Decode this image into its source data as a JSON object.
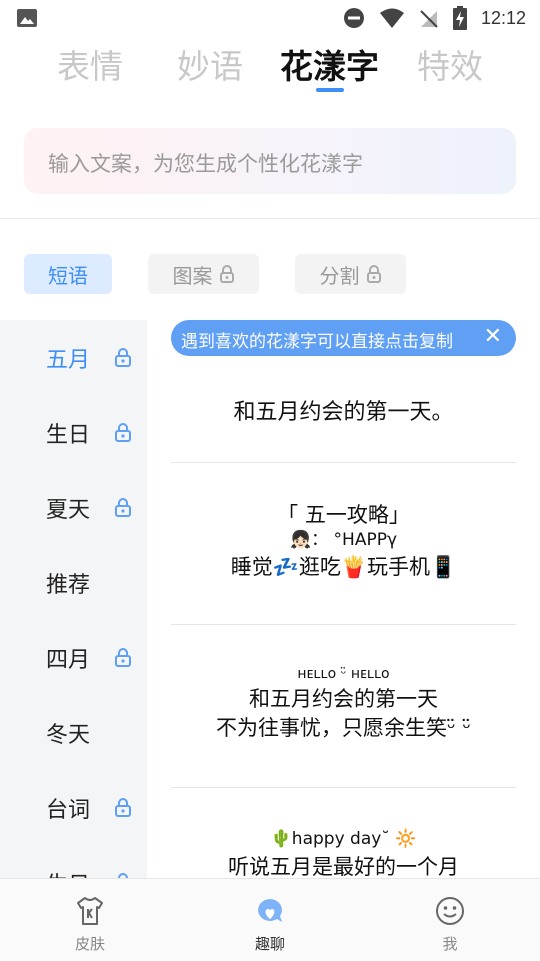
{
  "status_bar": {
    "time": "12:12"
  },
  "tabs": [
    {
      "label": "表情"
    },
    {
      "label": "妙语"
    },
    {
      "label": "花漾字"
    },
    {
      "label": "特效"
    }
  ],
  "search": {
    "placeholder": "输入文案，为您生成个性化花漾字"
  },
  "categories": [
    {
      "label": "短语"
    },
    {
      "label": "图案"
    },
    {
      "label": "分割"
    }
  ],
  "sidebar": {
    "items": [
      {
        "label": "五月"
      },
      {
        "label": "生日"
      },
      {
        "label": "夏天"
      },
      {
        "label": "推荐"
      },
      {
        "label": "四月"
      },
      {
        "label": "冬天"
      },
      {
        "label": "台词"
      },
      {
        "label": "生日"
      }
    ]
  },
  "tip": {
    "text": "遇到喜欢的花漾字可以直接点击复制",
    "close": "✕"
  },
  "cards": {
    "c1": {
      "line1": "和五月约会的第一天。"
    },
    "c2": {
      "line1": "「 五一攻略」",
      "line2": "👧🏻：  °HAPPγ",
      "line3": "睡觉💤逛吃🍟玩手机📱"
    },
    "c3": {
      "line1": "ʜᴇʟʟᴏ ᵕ̈ ʜᴇʟʟᴏ",
      "line2": "和五月约会的第一天",
      "line3": "不为往事忧，只愿余生笑ᵕ̈ ᵕ̈"
    },
    "c4": {
      "line1": "🌵happy day˘ 🔆",
      "line2": "听说五月是最好的一个月"
    }
  },
  "bottom_nav": [
    {
      "label": "皮肤"
    },
    {
      "label": "趣聊"
    },
    {
      "label": "我"
    }
  ],
  "colors": {
    "accent": "#3e8ef7",
    "tip_bg": "#5f9ff4"
  }
}
